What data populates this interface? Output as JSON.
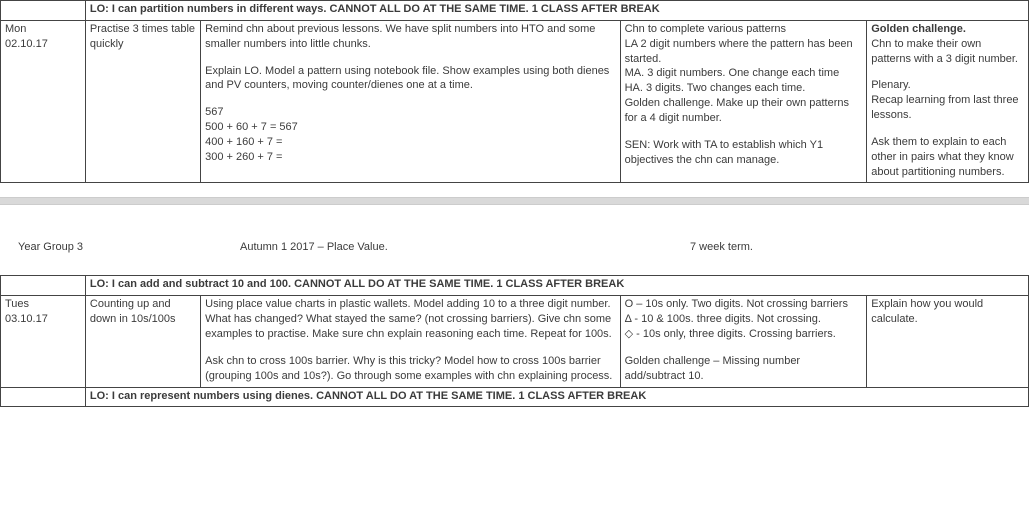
{
  "page1": {
    "lo": "LO: I can partition numbers in different ways. CANNOT ALL DO AT THE SAME TIME. 1 CLASS AFTER BREAK",
    "day": "Mon",
    "date": "02.10.17",
    "starter": "Practise 3 times table quickly",
    "main_p1": "Remind chn about previous lessons.  We have split numbers into HTO and some smaller numbers into little chunks.",
    "main_p2": "Explain LO.  Model a pattern using notebook file. Show examples using both dienes and PV counters, moving counter/dienes one at a time.",
    "main_l1": "567",
    "main_l2": "500 + 60 + 7 = 567",
    "main_l3": "400 + 160 + 7 =",
    "main_l4": "300 + 260 + 7 =",
    "task_p1": "Chn to complete various patterns",
    "task_p2": "LA 2 digit numbers where the pattern has been started.",
    "task_p3": "MA.  3 digit numbers. One change each time",
    "task_p4": "HA.  3 digits. Two changes each time.",
    "task_p5": "Golden challenge.  Make up their own patterns for a 4 digit number.",
    "task_p6": "SEN:  Work with TA to establish which Y1 objectives the chn can manage.",
    "plen_h1": "Golden challenge.",
    "plen_p1": "Chn to make their own patterns with a 3 digit number.",
    "plen_p2": "Plenary.",
    "plen_p3": "Recap learning from last three lessons.",
    "plen_p4": "Ask them to explain to each other in pairs what they know about partitioning numbers."
  },
  "header": {
    "year_group": "Year Group 3",
    "term": "Autumn 1 2017 – Place Value.",
    "weeks": "7 week term."
  },
  "page2": {
    "lo1": "LO: I can add and subtract 10 and 100. CANNOT ALL DO AT THE SAME TIME. 1 CLASS AFTER BREAK",
    "day": "Tues",
    "date": "03.10.17",
    "starter": "Counting up and down in 10s/100s",
    "main_p1": "Using place value charts in plastic wallets. Model adding 10 to a three digit number. What has changed? What stayed the same? (not crossing barriers). Give chn some examples to practise. Make sure chn explain reasoning each time. Repeat for 100s.",
    "main_p2": "Ask chn to cross 100s barrier. Why is this tricky? Model how to cross 100s barrier (grouping 100s and 10s?). Go through some examples with chn explaining process.",
    "task_p1": "O – 10s only. Two digits. Not crossing barriers",
    "task_p2": "Δ - 10 & 100s. three digits. Not crossing.",
    "task_p3": "◇ - 10s only, three digits. Crossing barriers.",
    "task_p4": "Golden challenge – Missing number add/subtract 10.",
    "plen_p1": "Explain how you would calculate.",
    "lo2": "LO: I can represent numbers using dienes. CANNOT ALL DO AT THE SAME TIME. 1 CLASS AFTER BREAK"
  }
}
